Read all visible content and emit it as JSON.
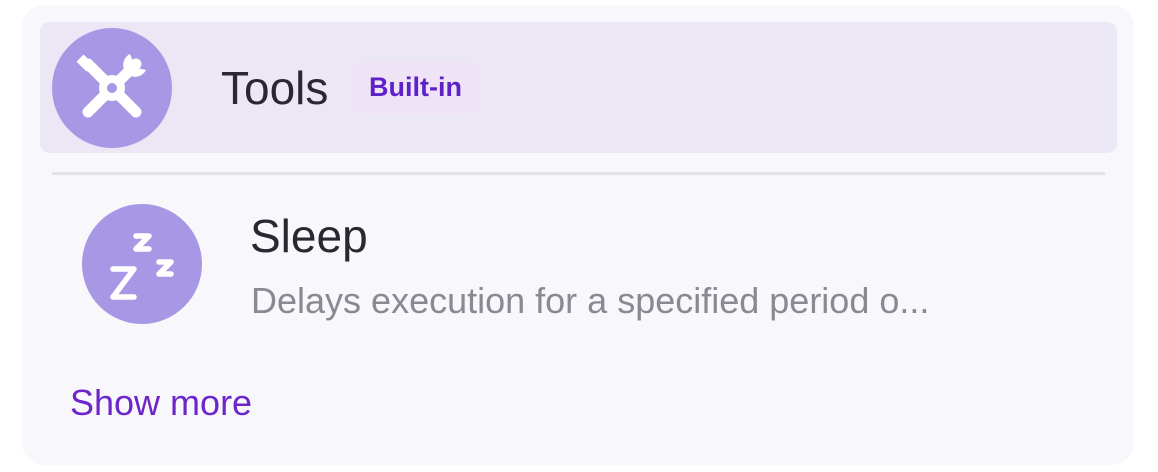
{
  "header": {
    "title": "Tools",
    "badge": "Built-in",
    "icon": "tools-icon"
  },
  "tools": [
    {
      "name": "Sleep",
      "description": "Delays execution for a specified period o...",
      "icon": "sleep-icon"
    }
  ],
  "footer": {
    "show_more_label": "Show more"
  },
  "colors": {
    "accent": "#6c26c9",
    "icon_background": "#a897e4",
    "header_background": "#ebe7f5",
    "badge_background": "#efe4f5",
    "panel_background": "#f8f7fc"
  }
}
